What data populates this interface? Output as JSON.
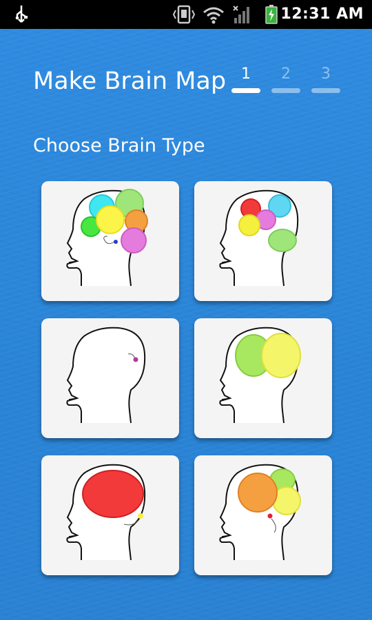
{
  "status_bar": {
    "time": "12:31 AM",
    "icons": [
      "usb-icon",
      "vibrate-icon",
      "wifi-icon",
      "signal-icon",
      "battery-charging-icon"
    ]
  },
  "header": {
    "title": "Make Brain Map",
    "steps": [
      {
        "label": "1",
        "state": "active"
      },
      {
        "label": "2",
        "state": "inactive"
      },
      {
        "label": "3",
        "state": "inactive"
      }
    ]
  },
  "section": {
    "label": "Choose Brain Type"
  },
  "brain_types": [
    {
      "id": "full-color-brain",
      "colors": [
        "#3fe7f0",
        "#9ee67a",
        "#47e640",
        "#fbf54a",
        "#f5a040",
        "#e57bdc"
      ]
    },
    {
      "id": "scattered-lobes",
      "colors": [
        "#f23a3a",
        "#5fd7f3",
        "#e57bdc",
        "#f5f03d",
        "#9ee67a"
      ]
    },
    {
      "id": "empty-head",
      "colors": [
        "#b03aa0"
      ]
    },
    {
      "id": "two-lobes",
      "colors": [
        "#a7e860",
        "#f5f56a"
      ]
    },
    {
      "id": "big-red-brain",
      "colors": [
        "#f23a3a",
        "#f5f03d"
      ]
    },
    {
      "id": "mixed-lobes",
      "colors": [
        "#f5a040",
        "#a7e860",
        "#f5f56a",
        "#e0203a"
      ]
    }
  ],
  "colors": {
    "background": "#2b86d8",
    "tile": "#f4f4f4"
  }
}
